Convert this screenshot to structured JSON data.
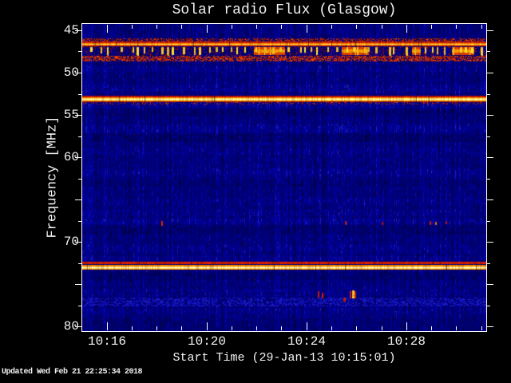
{
  "footer": {
    "updated_text": "Updated Wed Feb 21 22:25:34 2018"
  },
  "chart_data": {
    "type": "heatmap",
    "subtype": "radio-spectrogram",
    "title": "Solar radio Flux (Glasgow)",
    "xlabel": "Start Time (29-Jan-13 10:15:01)",
    "ylabel": "Frequency [MHz]",
    "x_start_time": "10:15:01",
    "x_end_time": "10:31:12",
    "x_span_min": 16.19,
    "x_major_ticks": [
      {
        "min": 0.983,
        "label": "10:16"
      },
      {
        "min": 4.983,
        "label": "10:20"
      },
      {
        "min": 8.983,
        "label": "10:24"
      },
      {
        "min": 12.983,
        "label": "10:28"
      }
    ],
    "x_minor_interval_min": 1,
    "y_range_mhz": [
      44.25,
      80.55
    ],
    "y_axis_increases_downward": true,
    "y_major_ticks": [
      {
        "f": 45,
        "label": "45"
      },
      {
        "f": 50,
        "label": "50"
      },
      {
        "f": 55,
        "label": "55"
      },
      {
        "f": 60,
        "label": "60"
      },
      {
        "f": 65,
        "label": ""
      },
      {
        "f": 70,
        "label": "70"
      },
      {
        "f": 75,
        "label": ""
      },
      {
        "f": 80,
        "label": "80"
      }
    ],
    "y_minor_ticks_mhz": [
      47.5,
      52.5,
      57.5,
      62.5,
      67.5,
      72.5,
      77.5
    ],
    "background_color": "#00007d",
    "palette": [
      "#000060",
      "#0000a0",
      "#4040d0",
      "#cc1c00",
      "#ff8800",
      "#ffd060",
      "#fff2c2"
    ],
    "bands": [
      {
        "type": "speckle",
        "f1": 45.95,
        "f2": 46.28,
        "density": 0.5,
        "colors": [
          "#a81400",
          "#d23c00",
          "#8c1000"
        ]
      },
      {
        "type": "gradient",
        "f1": 46.3,
        "f2": 46.78,
        "rows": [
          "#c02000",
          "#f07800",
          "#ffc84a",
          "#f07800",
          "#c02000"
        ]
      },
      {
        "type": "barcode",
        "f1": 46.85,
        "f2": 47.92,
        "speckle_color": "#8c1000",
        "speckle_density": 0.15,
        "dash_color": "#ffcc29",
        "dash_tip_color": "#b41e00",
        "segment_color": "#d84000",
        "segment_core_color": "#ff9800",
        "segments": [
          [
            0.425,
            0.5
          ],
          [
            0.642,
            0.708
          ],
          [
            0.816,
            0.836
          ],
          [
            0.915,
            0.968
          ]
        ]
      },
      {
        "type": "speckle",
        "f1": 48.02,
        "f2": 48.63,
        "density": 0.62,
        "colors": [
          "#b01600",
          "#e04400",
          "#c83000"
        ]
      },
      {
        "type": "gradient",
        "f1": 52.74,
        "f2": 53.4,
        "rows": [
          "#b71500",
          "#ff8800",
          "#ffce50",
          "#ffeba8",
          "#ffce50",
          "#ff8800",
          "#901200"
        ]
      },
      {
        "type": "speckle",
        "f1": 53.48,
        "f2": 53.72,
        "density": 0.22,
        "colors": [
          "#a81400",
          "#c03000"
        ]
      },
      {
        "type": "gradient",
        "f1": 72.3,
        "f2": 72.55,
        "rows": [
          "#cc1c00",
          "#c41c00"
        ]
      },
      {
        "type": "gradient",
        "f1": 72.73,
        "f2": 73.2,
        "rows": [
          "#f08000",
          "#ffd060",
          "#fff2c2",
          "#ffd060",
          "#f08000"
        ]
      },
      {
        "type": "light_speckle",
        "f1": 76.59,
        "f2": 77.49,
        "density": 0.5
      }
    ],
    "stripes": [
      {
        "f1": 49.2,
        "f2": 49.8,
        "d": 12
      },
      {
        "f1": 51.4,
        "f2": 52.3,
        "d": 14
      },
      {
        "f1": 53.5,
        "f2": 54.1,
        "d": 16
      },
      {
        "f1": 54.4,
        "f2": 55.1,
        "d": -12
      },
      {
        "f1": 56.1,
        "f2": 57.0,
        "d": 14
      },
      {
        "f1": 57.3,
        "f2": 58.1,
        "d": -16
      },
      {
        "f1": 59.0,
        "f2": 59.6,
        "d": 8
      },
      {
        "f1": 61.4,
        "f2": 62.2,
        "d": 12
      },
      {
        "f1": 62.6,
        "f2": 63.4,
        "d": -10
      },
      {
        "f1": 64.8,
        "f2": 65.6,
        "d": 8
      },
      {
        "f1": 66.2,
        "f2": 66.9,
        "d": 10
      },
      {
        "f1": 67.3,
        "f2": 67.8,
        "d": 16
      },
      {
        "f1": 68.1,
        "f2": 69.0,
        "d": -14
      },
      {
        "f1": 70.4,
        "f2": 71.1,
        "d": 10
      },
      {
        "f1": 71.7,
        "f2": 72.2,
        "d": 12
      },
      {
        "f1": 73.6,
        "f2": 74.4,
        "d": -12
      },
      {
        "f1": 75.6,
        "f2": 76.3,
        "d": 8
      },
      {
        "f1": 77.8,
        "f2": 78.4,
        "d": 10
      },
      {
        "f1": 79.0,
        "f2": 80.3,
        "d": -10
      }
    ],
    "features": [
      {
        "t": 0.196,
        "f": 67.5,
        "w": 2,
        "h": 6,
        "color": "#d42400"
      },
      {
        "t": 0.65,
        "f": 67.55,
        "w": 2,
        "h": 5,
        "color": "#b81800"
      },
      {
        "t": 0.741,
        "f": 67.6,
        "w": 2,
        "h": 4,
        "color": "#a81400"
      },
      {
        "t": 0.86,
        "f": 67.55,
        "w": 2,
        "h": 5,
        "color": "#c41c00"
      },
      {
        "t": 0.874,
        "f": 67.6,
        "w": 2,
        "h": 4,
        "color": "#e06000"
      },
      {
        "t": 0.899,
        "f": 67.55,
        "w": 2,
        "h": 4,
        "color": "#b01600"
      },
      {
        "t": 0.583,
        "f": 75.85,
        "w": 2,
        "h": 8,
        "color": "#c41c00"
      },
      {
        "t": 0.592,
        "f": 76.0,
        "w": 2,
        "h": 7,
        "color": "#cc2400"
      },
      {
        "t": 0.662,
        "f": 75.8,
        "w": 2,
        "h": 9,
        "color": "#c41c00"
      },
      {
        "t": 0.667,
        "f": 75.75,
        "w": 3,
        "h": 10,
        "color": "#ffc433"
      },
      {
        "t": 0.674,
        "f": 75.85,
        "w": 2,
        "h": 9,
        "color": "#c41c00"
      },
      {
        "t": 0.646,
        "f": 76.6,
        "w": 3,
        "h": 5,
        "color": "#c42200"
      }
    ]
  }
}
